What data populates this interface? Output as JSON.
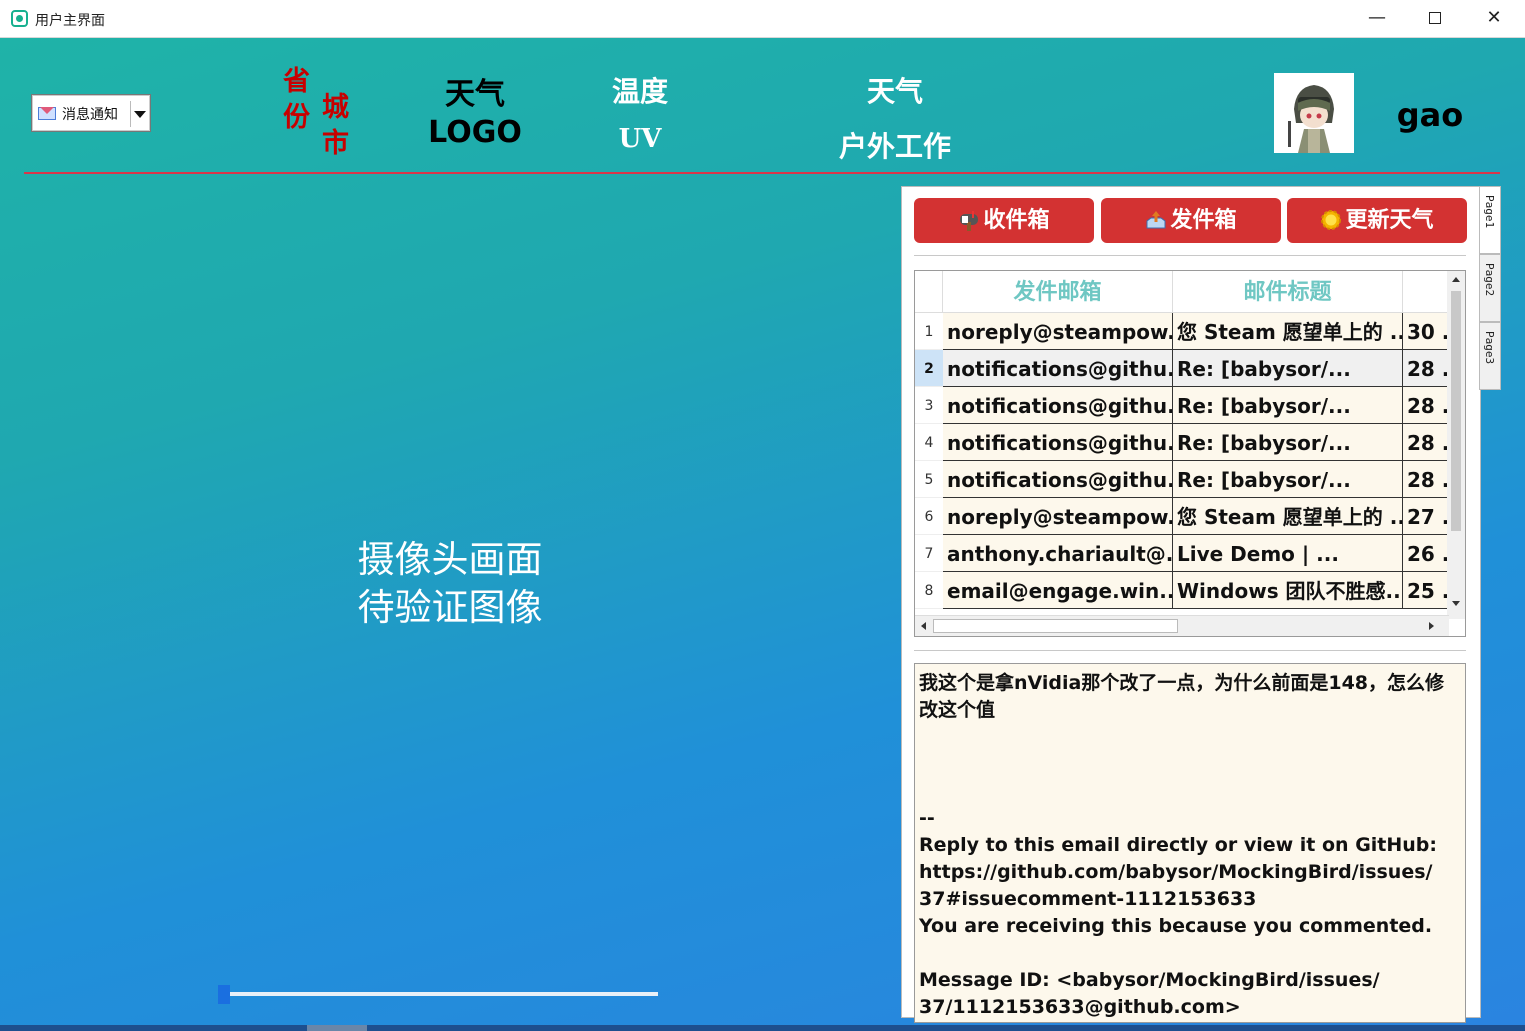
{
  "window": {
    "title": "用户主界面",
    "minimize": "—",
    "close": "✕"
  },
  "header": {
    "notify_select": "消息通知",
    "province": "省份",
    "city": "城市",
    "weather_logo_line1": "天气",
    "weather_logo_line2": "LOGO",
    "temperature": "温度",
    "uv": "UV",
    "weather": "天气",
    "outdoor_work": "户外工作",
    "username": "gao"
  },
  "camera": {
    "line1": "摄像头画面",
    "line2": "待验证图像",
    "slider_value": 0
  },
  "panel": {
    "tabs": [
      "Page1",
      "Page2",
      "Page3"
    ],
    "buttons": {
      "inbox": "收件箱",
      "outbox": "发件箱",
      "update_weather": "更新天气"
    },
    "table": {
      "columns": [
        "发件邮箱",
        "邮件标题",
        ""
      ],
      "selected_row": 2,
      "rows": [
        {
          "num": "1",
          "sender": "noreply@steampow...",
          "subject": "您 Steam 愿望单上的 ...",
          "date": "30 ."
        },
        {
          "num": "2",
          "sender": "notifications@githu...",
          "subject": "Re: [babysor/...",
          "date": "28 ."
        },
        {
          "num": "3",
          "sender": "notifications@githu...",
          "subject": "Re: [babysor/...",
          "date": "28 ."
        },
        {
          "num": "4",
          "sender": "notifications@githu...",
          "subject": "Re: [babysor/...",
          "date": "28 ."
        },
        {
          "num": "5",
          "sender": "notifications@githu...",
          "subject": "Re: [babysor/...",
          "date": "28 ."
        },
        {
          "num": "6",
          "sender": "noreply@steampow...",
          "subject": "您 Steam 愿望单上的 ...",
          "date": "27 ."
        },
        {
          "num": "7",
          "sender": "anthony.chariault@...",
          "subject": "Live Demo | ...",
          "date": "26 ."
        },
        {
          "num": "8",
          "sender": "email@engage.win...",
          "subject": "Windows 团队不胜感...",
          "date": "25 ."
        }
      ]
    },
    "mail_body": "我这个是拿nVidia那个改了一点，为什么前面是148，怎么修改这个值\n\n\n\n--\nReply to this email directly or view it on GitHub:\nhttps://github.com/babysor/MockingBird/issues/\n37#issuecomment-1112153633\nYou are receiving this because you commented.\n\nMessage ID: <babysor/MockingBird/issues/\n37/1112153633@github.com>"
  },
  "colors": {
    "accent_red": "#d33232",
    "province_red": "#c80000",
    "header_teal": "#6fc7c3",
    "divider_red": "#d9364a"
  }
}
